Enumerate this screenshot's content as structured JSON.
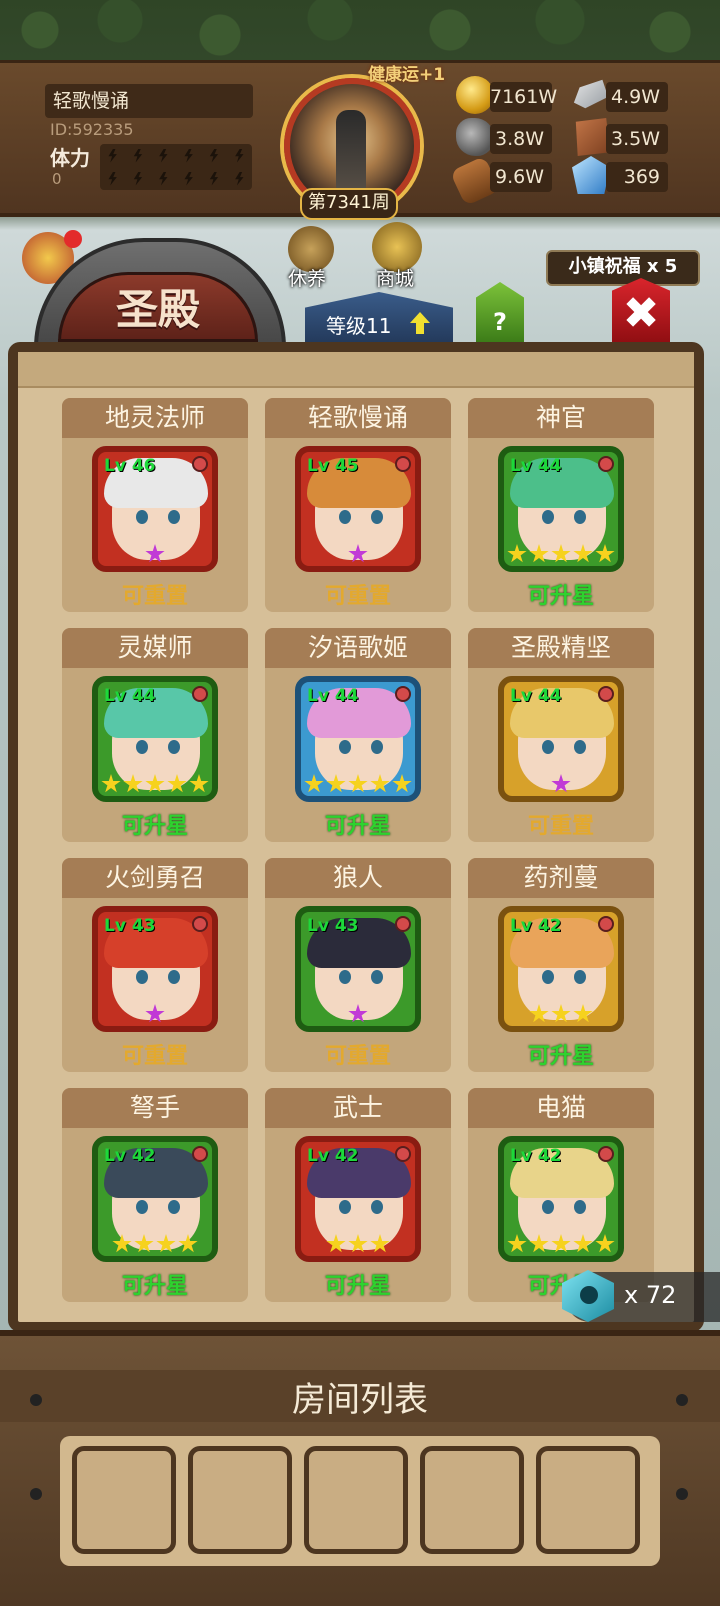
{
  "header": {
    "player_name": "轻歌慢诵",
    "player_id": "ID:592335",
    "stamina_label": "体力",
    "stamina_value": "0",
    "luck_text": "健康运+1",
    "week_text": "第7341周",
    "resources": {
      "gold": "7161W",
      "ingot": "4.9W",
      "ore": "3.8W",
      "hide": "3.5W",
      "wood": "9.6W",
      "crystal": "369"
    }
  },
  "menu": {
    "rest_label": "休养",
    "shop_label": "商城",
    "blessing_text": "小镇祝福 x 5",
    "level_label": "等级11",
    "help_label": "?",
    "close_label": "✖"
  },
  "hall": {
    "title": "圣殿",
    "heroes": [
      {
        "name": "地灵法师",
        "level": "Lv 46",
        "status": "可重置",
        "status_type": "reset",
        "frame": "red",
        "stars": 1,
        "star_type": "purple",
        "hair": "#e8e8e8"
      },
      {
        "name": "轻歌慢诵",
        "level": "Lv 45",
        "status": "可重置",
        "status_type": "reset",
        "frame": "red",
        "stars": 1,
        "star_type": "purple",
        "hair": "#d78b3a"
      },
      {
        "name": "神官",
        "level": "Lv 44",
        "status": "可升星",
        "status_type": "up",
        "frame": "green",
        "stars": 5,
        "star_type": "gold",
        "hair": "#4cbf8a"
      },
      {
        "name": "灵媒师",
        "level": "Lv 44",
        "status": "可升星",
        "status_type": "up",
        "frame": "green",
        "stars": 5,
        "star_type": "gold",
        "hair": "#58c7a8"
      },
      {
        "name": "汐语歌姬",
        "level": "Lv 44",
        "status": "可升星",
        "status_type": "up",
        "frame": "blue",
        "stars": 5,
        "star_type": "gold",
        "hair": "#e29ad8"
      },
      {
        "name": "圣殿精坚",
        "level": "Lv 44",
        "status": "可重置",
        "status_type": "reset",
        "frame": "gold",
        "stars": 1,
        "star_type": "purple",
        "hair": "#e8c86a"
      },
      {
        "name": "火剑勇召",
        "level": "Lv 43",
        "status": "可重置",
        "status_type": "reset",
        "frame": "red",
        "stars": 1,
        "star_type": "purple",
        "hair": "#d6402a"
      },
      {
        "name": "狼人",
        "level": "Lv 43",
        "status": "可重置",
        "status_type": "reset",
        "frame": "green",
        "stars": 1,
        "star_type": "purple",
        "hair": "#2b2b3a"
      },
      {
        "name": "药剂蔓",
        "level": "Lv 42",
        "status": "可升星",
        "status_type": "up",
        "frame": "gold",
        "stars": 3,
        "star_type": "gold",
        "hair": "#e9a45a"
      },
      {
        "name": "弩手",
        "level": "Lv 42",
        "status": "可升星",
        "status_type": "up",
        "frame": "green",
        "stars": 4,
        "star_type": "gold",
        "hair": "#3a4a5a"
      },
      {
        "name": "武士",
        "level": "Lv 42",
        "status": "可升星",
        "status_type": "up",
        "frame": "red",
        "stars": 3,
        "star_type": "gold",
        "hair": "#4a3a6a"
      },
      {
        "name": "电猫",
        "level": "Lv 42",
        "status": "可升星",
        "status_type": "up",
        "frame": "green",
        "stars": 5,
        "star_type": "gold",
        "hair": "#e8d48a"
      }
    ],
    "token_count": "x 72"
  },
  "rooms": {
    "title": "房间列表",
    "slot_count": 5
  }
}
